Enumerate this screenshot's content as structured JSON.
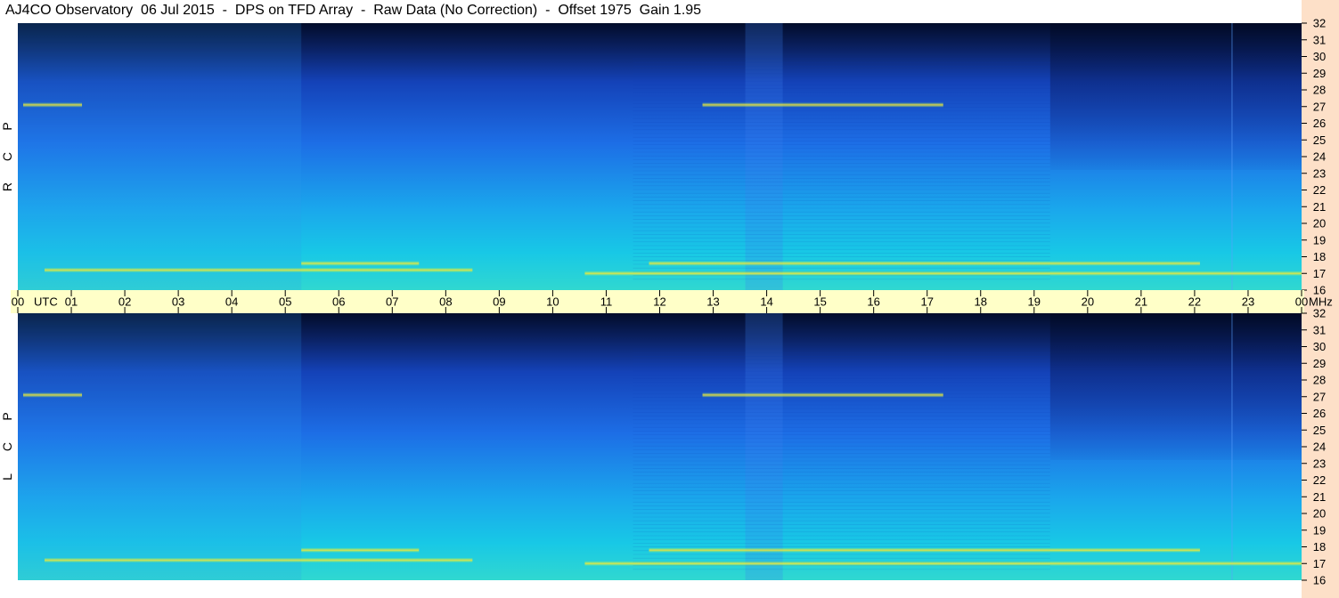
{
  "title": "AJ4CO Observatory  06 Jul 2015  -  DPS on TFD Array  -  Raw Data (No Correction)  -  Offset 1975  Gain 1.95",
  "colors": {
    "time_bar": "#ffffc8",
    "freq_axis_bg": "#fde0c8",
    "background": "#ffffff",
    "spectrogram_dark": "#051a4a",
    "spectrogram_mid": "#1a72e6",
    "spectrogram_cyan": "#18c8e8",
    "spectrogram_hot": "#ffe830"
  },
  "chart_data": [
    {
      "type": "heatmap",
      "panel": "RCP",
      "polarization_label": [
        "R",
        "C",
        "P"
      ],
      "x_ticks": [
        "00",
        "UTC",
        "01",
        "02",
        "03",
        "04",
        "05",
        "06",
        "07",
        "08",
        "09",
        "10",
        "11",
        "12",
        "13",
        "14",
        "15",
        "16",
        "17",
        "18",
        "19",
        "20",
        "21",
        "22",
        "23",
        "00",
        "MHz"
      ],
      "x_range_hours": [
        0,
        24
      ],
      "y_ticks": [
        32,
        31,
        30,
        29,
        28,
        27,
        26,
        25,
        24,
        23,
        22,
        21,
        20,
        19,
        18,
        17,
        16
      ],
      "y_range_mhz": [
        16,
        32
      ],
      "bright_bands": [
        {
          "freq_mhz": 17.2,
          "start_h": 0.5,
          "end_h": 8.5
        },
        {
          "freq_mhz": 17.6,
          "start_h": 5.3,
          "end_h": 7.5
        },
        {
          "freq_mhz": 17.6,
          "start_h": 11.8,
          "end_h": 22.1
        },
        {
          "freq_mhz": 17.0,
          "start_h": 10.6,
          "end_h": 24.0
        },
        {
          "freq_mhz": 27.1,
          "start_h": 12.8,
          "end_h": 17.3
        },
        {
          "freq_mhz": 27.1,
          "start_h": 0.1,
          "end_h": 1.2
        }
      ]
    },
    {
      "type": "heatmap",
      "panel": "LCP",
      "polarization_label": [
        "L",
        "C",
        "P"
      ],
      "x_range_hours": [
        0,
        24
      ],
      "y_ticks": [
        32,
        31,
        30,
        29,
        28,
        27,
        26,
        25,
        24,
        23,
        22,
        21,
        20,
        19,
        18,
        17,
        16
      ],
      "y_range_mhz": [
        16,
        32
      ],
      "bright_bands": [
        {
          "freq_mhz": 17.2,
          "start_h": 0.5,
          "end_h": 8.5
        },
        {
          "freq_mhz": 17.8,
          "start_h": 5.3,
          "end_h": 7.5
        },
        {
          "freq_mhz": 17.8,
          "start_h": 11.8,
          "end_h": 22.1
        },
        {
          "freq_mhz": 17.0,
          "start_h": 10.6,
          "end_h": 24.0
        },
        {
          "freq_mhz": 27.1,
          "start_h": 12.8,
          "end_h": 17.3
        },
        {
          "freq_mhz": 27.1,
          "start_h": 0.1,
          "end_h": 1.2
        }
      ]
    }
  ]
}
